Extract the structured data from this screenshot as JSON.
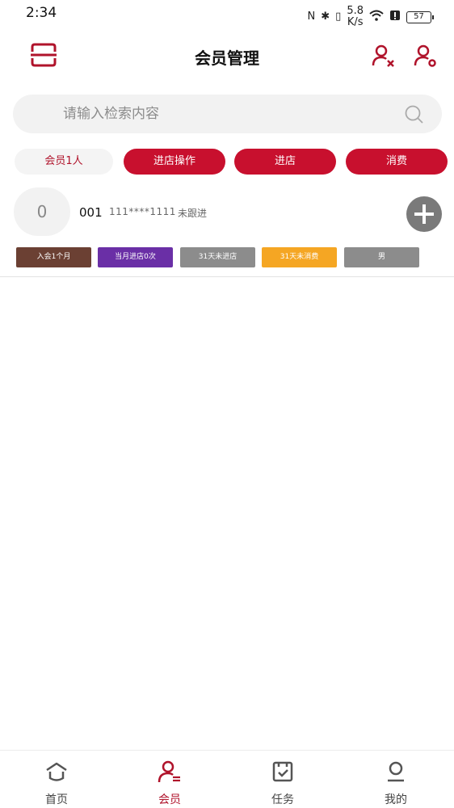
{
  "status_bar": {
    "time": "2:34",
    "nfc": "N",
    "bluetooth": "✱",
    "vibrate": "▯",
    "net_speed_top": "5.8",
    "net_speed_bottom": "K/s",
    "battery": "57"
  },
  "header": {
    "title": "会员管理",
    "scan_icon": "scan-icon",
    "remove_member_icon": "user-remove-icon",
    "member_settings_icon": "user-settings-icon"
  },
  "search": {
    "placeholder": "请输入检索内容",
    "value": ""
  },
  "filters": {
    "count_label": "会员1人",
    "actions": [
      "进店操作",
      "进店",
      "消费"
    ]
  },
  "member": {
    "avatar_text": "0",
    "code": "001",
    "phone": "111****1111",
    "follow_status": "未跟进",
    "tags": [
      "入会1个月",
      "当月进店0次",
      "31天未进店",
      "31天未消费",
      "男"
    ]
  },
  "bottom_nav": {
    "items": [
      {
        "label": "首页",
        "icon": "home-icon"
      },
      {
        "label": "会员",
        "icon": "member-icon"
      },
      {
        "label": "任务",
        "icon": "task-icon"
      },
      {
        "label": "我的",
        "icon": "profile-icon"
      }
    ],
    "active": "会员"
  },
  "colors": {
    "accent": "#c8102e",
    "tag_join": "#6b4033",
    "tag_visits": "#6a2fa6",
    "tag_gray": "#8c8c8c",
    "tag_orange": "#f5a623"
  }
}
